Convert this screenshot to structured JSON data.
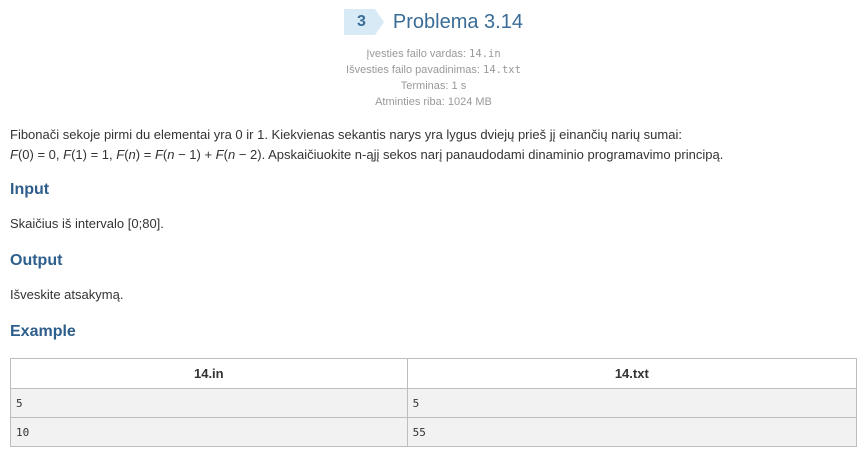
{
  "header": {
    "badge": "3",
    "title": "Problema 3.14"
  },
  "meta": {
    "input_label": "Įvesties failo vardas:",
    "input_file": "14.in",
    "output_label": "Išvesties failo pavadinimas:",
    "output_file": "14.txt",
    "time_label": "Terminas:",
    "time_value": "1 s",
    "memory_label": "Atminties riba:",
    "memory_value": "1024 MB"
  },
  "statement": {
    "line1": "Fibonači sekoje pirmi du elementai yra 0 ir 1. Kiekvienas sekantis narys yra lygus dviejų prieš jį einančių narių sumai:",
    "line2": ". Apskaičiuokite n-ąjį sekos narį panaudodami dinaminio programavimo principą."
  },
  "sections": {
    "input_title": "Input",
    "input_text": "Skaičius iš intervalo [0;80].",
    "output_title": "Output",
    "output_text": "Išveskite atsakymą.",
    "example_title": "Example"
  },
  "example": {
    "headers": [
      "14.in",
      "14.txt"
    ],
    "rows": [
      [
        "5",
        "5"
      ],
      [
        "10",
        "55"
      ]
    ]
  }
}
